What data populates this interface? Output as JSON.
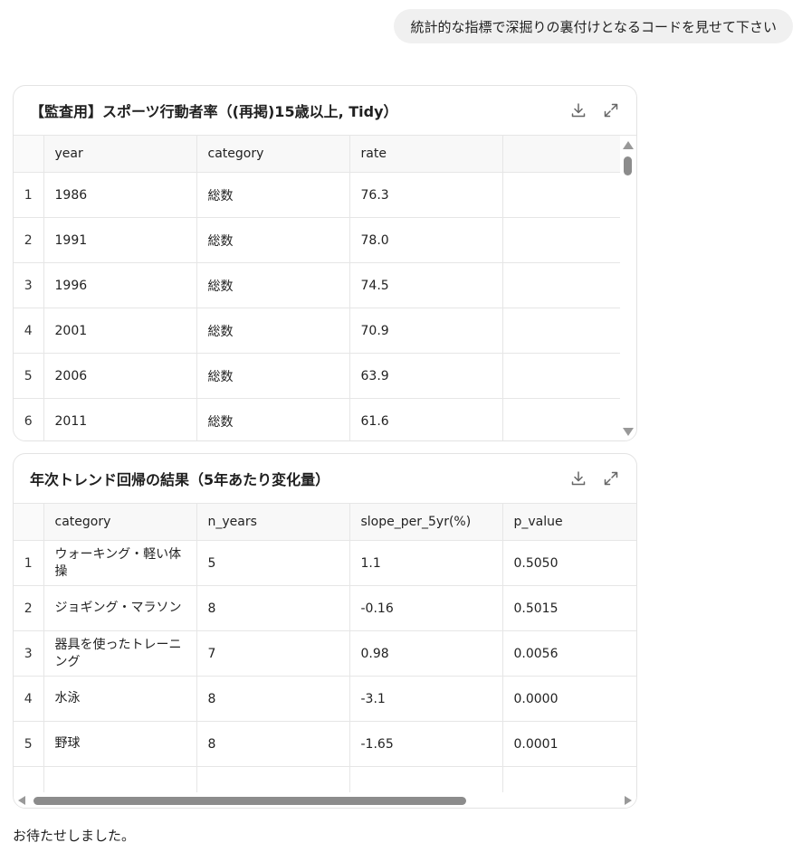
{
  "user_message": "統計的な指標で深掘りの裏付けとなるコードを見せて下さい",
  "table1": {
    "title": "【監査用】スポーツ行動者率（(再掲)15歳以上, Tidy）",
    "columns": [
      "",
      "year",
      "category",
      "rate",
      ""
    ],
    "rows": [
      [
        "1",
        "1986",
        "総数",
        "76.3"
      ],
      [
        "2",
        "1991",
        "総数",
        "78.0"
      ],
      [
        "3",
        "1996",
        "総数",
        "74.5"
      ],
      [
        "4",
        "2001",
        "総数",
        "70.9"
      ],
      [
        "5",
        "2006",
        "総数",
        "63.9"
      ],
      [
        "6",
        "2011",
        "総数",
        "61.6"
      ]
    ]
  },
  "table2": {
    "title": "年次トレンド回帰の結果（5年あたり変化量）",
    "columns": [
      "",
      "category",
      "n_years",
      "slope_per_5yr(%)",
      "p_value"
    ],
    "rows": [
      [
        "1",
        "ウォーキング・軽い体操",
        "5",
        "1.1",
        "0.5050"
      ],
      [
        "2",
        "ジョギング・マラソン",
        "8",
        "-0.16",
        "0.5015"
      ],
      [
        "3",
        "器具を使ったトレーニング",
        "7",
        "0.98",
        "0.0056"
      ],
      [
        "4",
        "水泳",
        "8",
        "-3.1",
        "0.0000"
      ],
      [
        "5",
        "野球",
        "8",
        "-1.65",
        "0.0001"
      ]
    ]
  },
  "icons": {
    "download": "download-icon",
    "expand": "expand-icon"
  },
  "footer_text": "お待たせしました。"
}
